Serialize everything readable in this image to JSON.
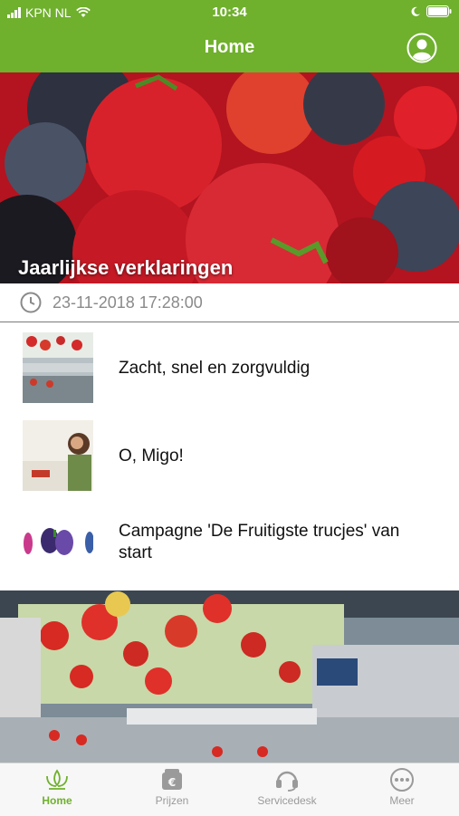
{
  "status_bar": {
    "carrier": "KPN NL",
    "time": "10:34"
  },
  "header": {
    "title": "Home"
  },
  "hero": {
    "title": "Jaarlijkse verklaringen",
    "date": "23-11-2018 17:28:00"
  },
  "news": [
    {
      "title": "Zacht, snel  en zorgvuldig"
    },
    {
      "title": "O, Migo!"
    },
    {
      "title": "Campagne 'De Fruitigste trucjes' van start"
    }
  ],
  "tabs": [
    {
      "label": "Home",
      "icon": "home-leaf-icon",
      "active": true
    },
    {
      "label": "Prijzen",
      "icon": "wallet-euro-icon",
      "active": false
    },
    {
      "label": "Servicedesk",
      "icon": "headset-icon",
      "active": false
    },
    {
      "label": "Meer",
      "icon": "more-icon",
      "active": false
    }
  ],
  "colors": {
    "brand": "#6fb02d",
    "tab_inactive": "#9a9a9a"
  }
}
